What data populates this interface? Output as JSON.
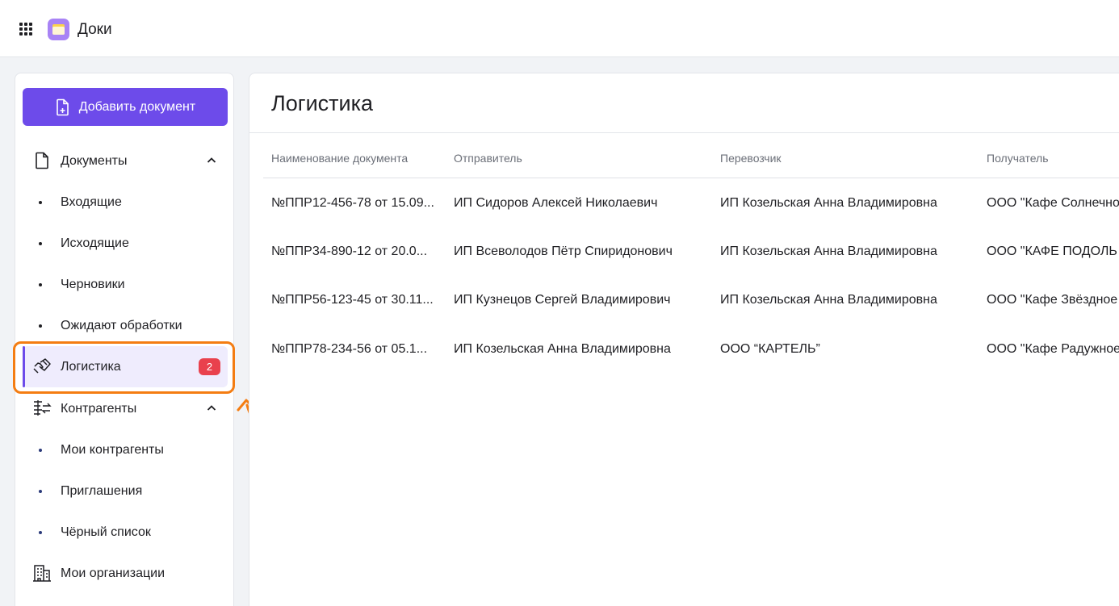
{
  "app": {
    "title": "Доки"
  },
  "sidebar": {
    "add_button_label": "Добавить документ",
    "documents": {
      "label": "Документы",
      "items": [
        "Входящие",
        "Исходящие",
        "Черновики",
        "Ожидают обработки"
      ]
    },
    "logistics": {
      "label": "Логистика",
      "badge": "2"
    },
    "counterparties": {
      "label": "Контрагенты",
      "items": [
        "Мои контрагенты",
        "Приглашения",
        "Чёрный список"
      ]
    },
    "organizations": {
      "label": "Мои организации"
    }
  },
  "main": {
    "title": "Логистика",
    "columns": [
      "Наименование документа",
      "Отправитель",
      "Перевозчик",
      "Получатель"
    ],
    "rows": [
      [
        "№ППР12-456-78 от 15.09...",
        "ИП Сидоров Алексей Николаевич",
        "ИП Козельская Анна Владимировна",
        "ООО \"Кафе Солнечно"
      ],
      [
        "№ППР34-890-12 от 20.0...",
        "ИП Всеволодов Пётр Спиридонович",
        "ИП Козельская Анна Владимировна",
        "ООО \"КАФЕ ПОДОЛЬ"
      ],
      [
        "№ППР56-123-45 от 30.11...",
        "ИП Кузнецов Сергей Владимирович",
        "ИП Козельская Анна Владимировна",
        "ООО \"Кафе Звёздное"
      ],
      [
        "№ППР78-234-56 от 05.1...",
        "ИП Козельская Анна Владимировна",
        "ООО “КАРТЕЛЬ”",
        "ООО \"Кафе Радужное"
      ]
    ]
  },
  "colors": {
    "accent": "#6d4bea",
    "badge": "#e9414d",
    "highlight": "#f47d12"
  },
  "icons": {
    "apps": "apps-grid-icon",
    "logo": "folder-logo-icon",
    "add": "add-document-icon",
    "documents": "document-icon",
    "logistics": "hand-box-icon",
    "counterparties": "exchange-icon",
    "organizations": "building-icon"
  }
}
